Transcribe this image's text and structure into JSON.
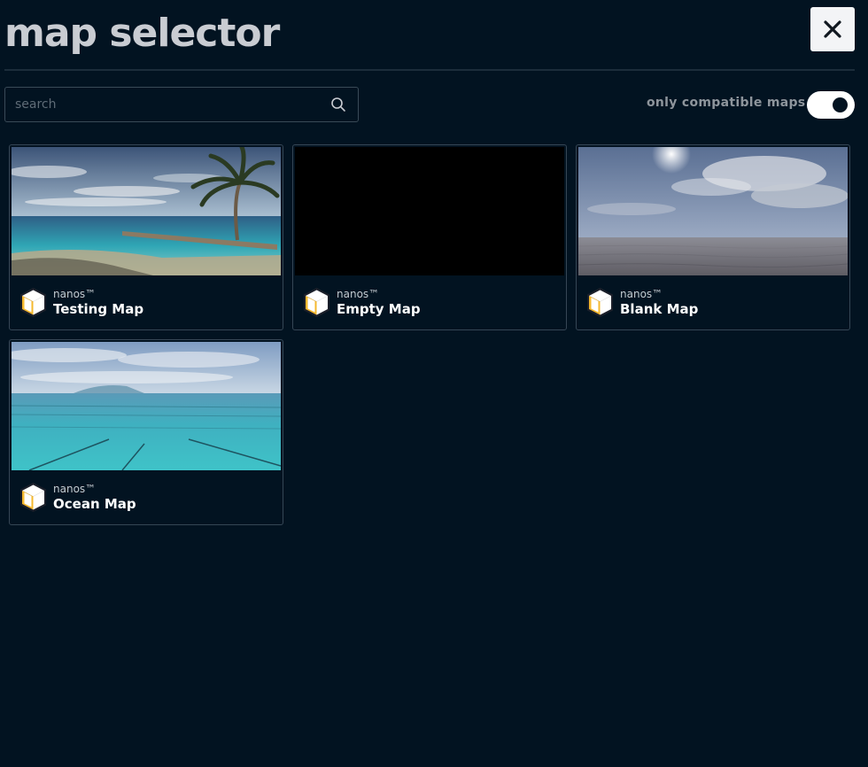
{
  "header": {
    "title": "map selector",
    "close_icon": "close-icon"
  },
  "search": {
    "placeholder": "search",
    "value": "",
    "icon": "search-icon"
  },
  "filter": {
    "label": "only compatible maps",
    "enabled": true
  },
  "maps": [
    {
      "author": "nanos™",
      "name": "Testing Map",
      "thumbnail": "tropical-beach-with-palm-tree"
    },
    {
      "author": "nanos™",
      "name": "Empty Map",
      "thumbnail": "black"
    },
    {
      "author": "nanos™",
      "name": "Blank Map",
      "thumbnail": "cloudy-sky-over-flat-sand"
    },
    {
      "author": "nanos™",
      "name": "Ocean Map",
      "thumbnail": "open-ocean-with-grid"
    }
  ],
  "colors": {
    "background": "#021321",
    "title": "#c9ccd2",
    "border": "#364655",
    "package_icon": "#f5b82e"
  }
}
